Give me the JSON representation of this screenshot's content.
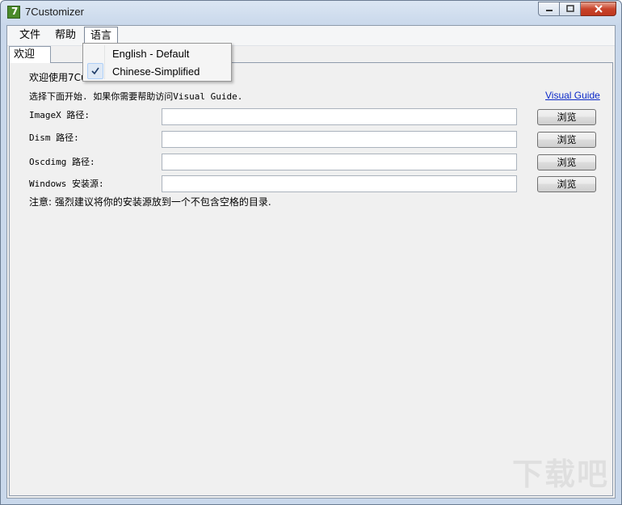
{
  "window": {
    "title": "7Customizer"
  },
  "menu": {
    "items": [
      "文件",
      "帮助",
      "语言"
    ]
  },
  "language_menu": {
    "items": [
      {
        "label": "English - Default",
        "checked": false
      },
      {
        "label": "Chinese-Simplified",
        "checked": true
      }
    ]
  },
  "tabs": [
    "欢迎"
  ],
  "welcome": {
    "greeting": "欢迎使用7Cus",
    "intro": "选择下面开始. 如果你需要帮助访问Visual Guide.",
    "visual_guide_link": "Visual Guide",
    "fields": [
      {
        "label": "ImageX 路径:",
        "value": "",
        "button": "浏览"
      },
      {
        "label": "Dism 路径:",
        "value": "",
        "button": "浏览"
      },
      {
        "label": "Oscdimg 路径:",
        "value": "",
        "button": "浏览"
      },
      {
        "label": "Windows 安装源:",
        "value": "",
        "button": "浏览"
      }
    ],
    "note": "注意: 强烈建议将你的安装源放到一个不包含空格的目录."
  },
  "watermark": "下载吧"
}
